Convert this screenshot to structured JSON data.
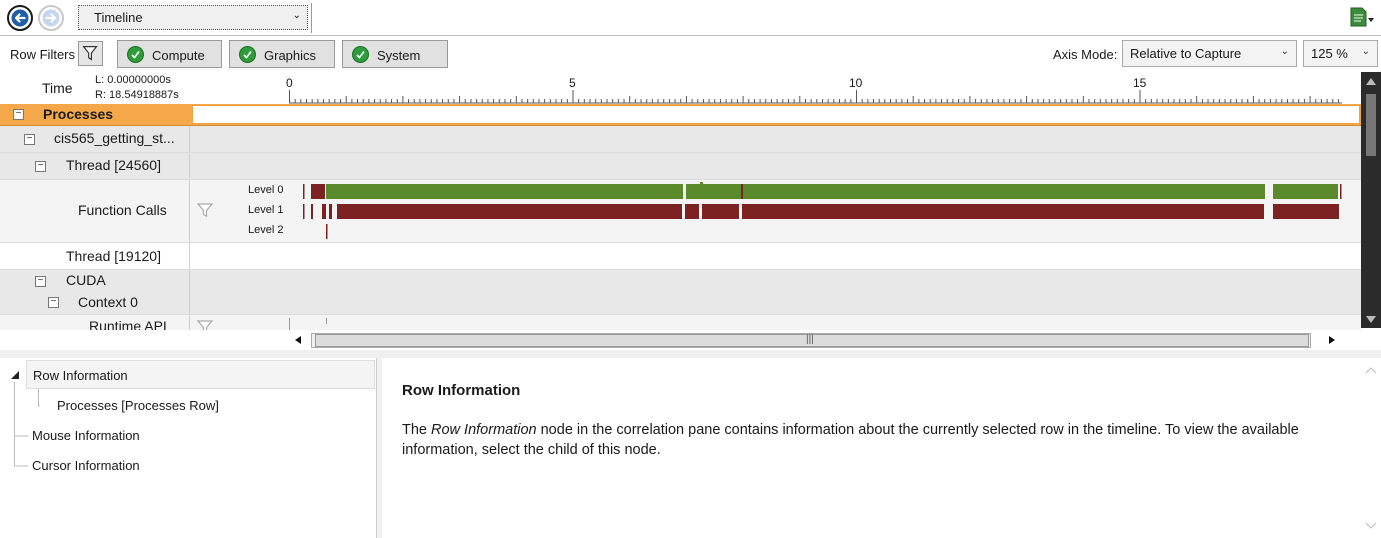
{
  "toolbar": {
    "back_icon": "back-arrow-icon",
    "forward_icon": "forward-arrow-icon",
    "view_selected": "Timeline",
    "export_icon": "export-document-icon"
  },
  "filterbar": {
    "row_filters_label": "Row Filters",
    "chips": [
      {
        "label": "Compute",
        "checked": true
      },
      {
        "label": "Graphics",
        "checked": true
      },
      {
        "label": "System",
        "checked": true
      }
    ],
    "axis_mode_label": "Axis Mode:",
    "axis_mode_value": "Relative to Capture",
    "zoom_value": "125 %"
  },
  "timeline": {
    "time_label": "Time",
    "left_time": "L: 0.00000000s",
    "right_time": "R: 18.54918887s",
    "axis_ticks": [
      "0",
      "5",
      "10",
      "15"
    ],
    "axis_range": [
      0,
      18.54918887
    ],
    "level_labels": [
      "Level 0",
      "Level 1",
      "Level 2"
    ],
    "colors": {
      "selected_row": "#f5a84a",
      "level0": "#5a8a2c",
      "level1": "#7d2222"
    }
  },
  "tree": {
    "processes": "Processes",
    "process_name": "cis565_getting_st...",
    "thread1": "Thread [24560]",
    "function_calls": "Function Calls",
    "thread2": "Thread [19120]",
    "cuda": "CUDA",
    "context": "Context 0",
    "runtime_api": "Runtime API"
  },
  "info": {
    "nodes": {
      "row_information": "Row Information",
      "processes_row": "Processes [Processes Row]",
      "mouse_information": "Mouse Information",
      "cursor_information": "Cursor Information"
    },
    "doc_title": "Row Information",
    "doc_text_1": "The ",
    "doc_text_em": "Row Information",
    "doc_text_2": " node in the correlation pane contains information about the currently selected row in the timeline. To view the available information, select the child of this node."
  }
}
